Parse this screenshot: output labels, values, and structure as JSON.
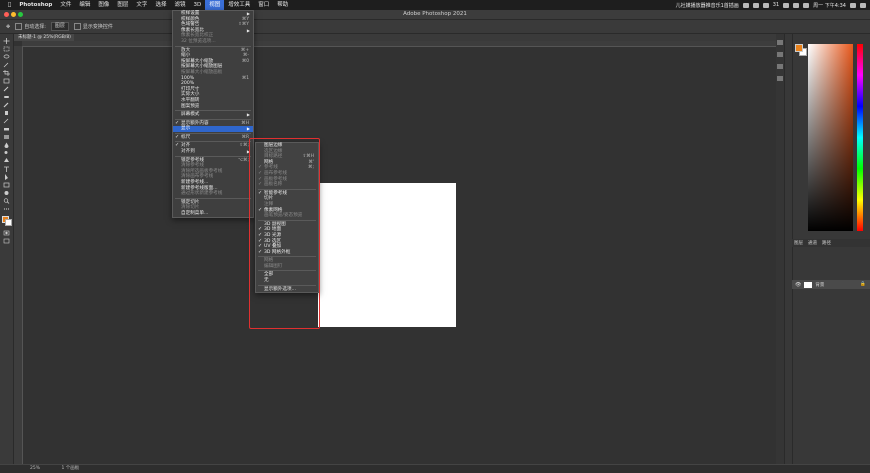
{
  "menubar": {
    "app": "Photoshop",
    "items": [
      "文件",
      "编辑",
      "图像",
      "图层",
      "文字",
      "选择",
      "滤镜",
      "3D",
      "视图",
      "增效工具",
      "窗口",
      "帮助"
    ],
    "active_index": 8,
    "right_text": "儿社媒播放器推音乐1首插画",
    "battery": "31",
    "clock": "周一 下午4:34"
  },
  "window": {
    "title": "Adobe Photoshop 2021"
  },
  "options": {
    "auto_select": "自动选择:",
    "layer_dropdown": "图层",
    "show_transform": "显示变换控件"
  },
  "document_tab": {
    "label": "未标题-1 @ 25%(RGB/8)"
  },
  "view_menu": {
    "items": [
      {
        "label": "校样设置",
        "shortcut": "",
        "arrow": true,
        "disabled": false
      },
      {
        "label": "校样颜色",
        "shortcut": "⌘Y",
        "arrow": false,
        "disabled": false
      },
      {
        "label": "色域警告",
        "shortcut": "⇧⌘Y",
        "arrow": false,
        "disabled": false
      },
      {
        "label": "像素长宽比",
        "shortcut": "",
        "arrow": true,
        "disabled": false
      },
      {
        "label": "像素长宽比校正",
        "shortcut": "",
        "arrow": false,
        "disabled": true
      },
      {
        "label": "32 位预览选项...",
        "shortcut": "",
        "arrow": false,
        "disabled": true
      },
      {
        "sep": true
      },
      {
        "label": "放大",
        "shortcut": "⌘+",
        "arrow": false,
        "disabled": false
      },
      {
        "label": "缩小",
        "shortcut": "⌘-",
        "arrow": false,
        "disabled": false
      },
      {
        "label": "按屏幕大小缩放",
        "shortcut": "⌘0",
        "arrow": false,
        "disabled": false
      },
      {
        "label": "按屏幕大小缩放图层",
        "shortcut": "",
        "arrow": false,
        "disabled": false
      },
      {
        "label": "按屏幕大小缩放画板",
        "shortcut": "",
        "arrow": false,
        "disabled": true
      },
      {
        "label": "100%",
        "shortcut": "⌘1",
        "arrow": false,
        "disabled": false
      },
      {
        "label": "200%",
        "shortcut": "",
        "arrow": false,
        "disabled": false
      },
      {
        "label": "打印尺寸",
        "shortcut": "",
        "arrow": false,
        "disabled": false
      },
      {
        "label": "实际大小",
        "shortcut": "",
        "arrow": false,
        "disabled": false
      },
      {
        "label": "水平翻转",
        "shortcut": "",
        "arrow": false,
        "disabled": false
      },
      {
        "label": "图案预览",
        "shortcut": "",
        "arrow": false,
        "disabled": false
      },
      {
        "sep": true
      },
      {
        "label": "屏幕模式",
        "shortcut": "",
        "arrow": true,
        "disabled": false
      },
      {
        "sep": true
      },
      {
        "label": "显示额外内容",
        "shortcut": "⌘H",
        "arrow": false,
        "disabled": false,
        "checked": true
      },
      {
        "label": "显示",
        "shortcut": "",
        "arrow": true,
        "disabled": false,
        "highlight": true
      },
      {
        "sep": true
      },
      {
        "label": "标尺",
        "shortcut": "⌘R",
        "arrow": false,
        "disabled": false,
        "checked": true
      },
      {
        "sep": true
      },
      {
        "label": "对齐",
        "shortcut": "⇧⌘;",
        "arrow": false,
        "disabled": false,
        "checked": true
      },
      {
        "label": "对齐到",
        "shortcut": "",
        "arrow": true,
        "disabled": false
      },
      {
        "sep": true
      },
      {
        "label": "锁定参考线",
        "shortcut": "⌥⌘;",
        "arrow": false,
        "disabled": false
      },
      {
        "label": "清除参考线",
        "shortcut": "",
        "arrow": false,
        "disabled": true
      },
      {
        "label": "清除所选画板参考线",
        "shortcut": "",
        "arrow": false,
        "disabled": true
      },
      {
        "label": "清除画布参考线",
        "shortcut": "",
        "arrow": false,
        "disabled": true
      },
      {
        "label": "新建参考线...",
        "shortcut": "",
        "arrow": false,
        "disabled": false
      },
      {
        "label": "新建参考线版面...",
        "shortcut": "",
        "arrow": false,
        "disabled": false
      },
      {
        "label": "通过形状新建参考线",
        "shortcut": "",
        "arrow": false,
        "disabled": true
      },
      {
        "sep": true
      },
      {
        "label": "锁定切片",
        "shortcut": "",
        "arrow": false,
        "disabled": false
      },
      {
        "label": "清除切片",
        "shortcut": "",
        "arrow": false,
        "disabled": true
      },
      {
        "label": "自定制菜单...",
        "shortcut": "",
        "arrow": false,
        "disabled": false
      }
    ]
  },
  "show_menu": {
    "items": [
      {
        "label": "图层边缘",
        "shortcut": "",
        "disabled": false,
        "checked": false
      },
      {
        "label": "选区边缘",
        "shortcut": "",
        "disabled": true,
        "checked": false
      },
      {
        "label": "目标路径",
        "shortcut": "⇧⌘H",
        "disabled": true,
        "checked": false
      },
      {
        "label": "网格",
        "shortcut": "⌘'",
        "disabled": false,
        "checked": false
      },
      {
        "label": "参考线",
        "shortcut": "⌘;",
        "disabled": true,
        "checked": true
      },
      {
        "label": "画布参考线",
        "shortcut": "",
        "disabled": true,
        "checked": true
      },
      {
        "label": "画板参考线",
        "shortcut": "",
        "disabled": true,
        "checked": true
      },
      {
        "label": "画板名称",
        "shortcut": "",
        "disabled": true,
        "checked": true
      },
      {
        "sep": true
      },
      {
        "label": "智能参考线",
        "shortcut": "",
        "disabled": false,
        "checked": true
      },
      {
        "label": "切片",
        "shortcut": "",
        "disabled": false,
        "checked": false
      },
      {
        "label": "注释",
        "shortcut": "",
        "disabled": true,
        "checked": false
      },
      {
        "label": "像素网格",
        "shortcut": "",
        "disabled": false,
        "checked": true
      },
      {
        "label": "画笔预览/姿态预览",
        "shortcut": "",
        "disabled": true,
        "checked": false
      },
      {
        "sep": true
      },
      {
        "label": "3D 副视图",
        "shortcut": "",
        "disabled": false,
        "checked": false
      },
      {
        "label": "3D 地面",
        "shortcut": "",
        "disabled": false,
        "checked": true
      },
      {
        "label": "3D 光源",
        "shortcut": "",
        "disabled": false,
        "checked": true
      },
      {
        "label": "3D 选区",
        "shortcut": "",
        "disabled": false,
        "checked": true
      },
      {
        "label": "UV 叠加",
        "shortcut": "",
        "disabled": false,
        "checked": true
      },
      {
        "label": "3D 网格外框",
        "shortcut": "",
        "disabled": false,
        "checked": true
      },
      {
        "sep": true
      },
      {
        "label": "网格",
        "shortcut": "",
        "disabled": true,
        "checked": false
      },
      {
        "label": "编辑图钉",
        "shortcut": "",
        "disabled": true,
        "checked": false
      },
      {
        "sep": true
      },
      {
        "label": "全部",
        "shortcut": "",
        "disabled": false,
        "checked": false
      },
      {
        "label": "无",
        "shortcut": "",
        "disabled": false,
        "checked": false
      },
      {
        "sep": true
      },
      {
        "label": "显示额外选项...",
        "shortcut": "",
        "disabled": false,
        "checked": false
      }
    ]
  },
  "panels": {
    "layers_tabs": [
      "图层",
      "通道",
      "路径"
    ],
    "layer_name": "背景"
  },
  "status": {
    "zoom": "25%",
    "info": "1 个画板"
  },
  "colors": {
    "accent": "#2f66cc",
    "highlight_box": "#e03030",
    "fg_swatch": "#e8821c"
  }
}
